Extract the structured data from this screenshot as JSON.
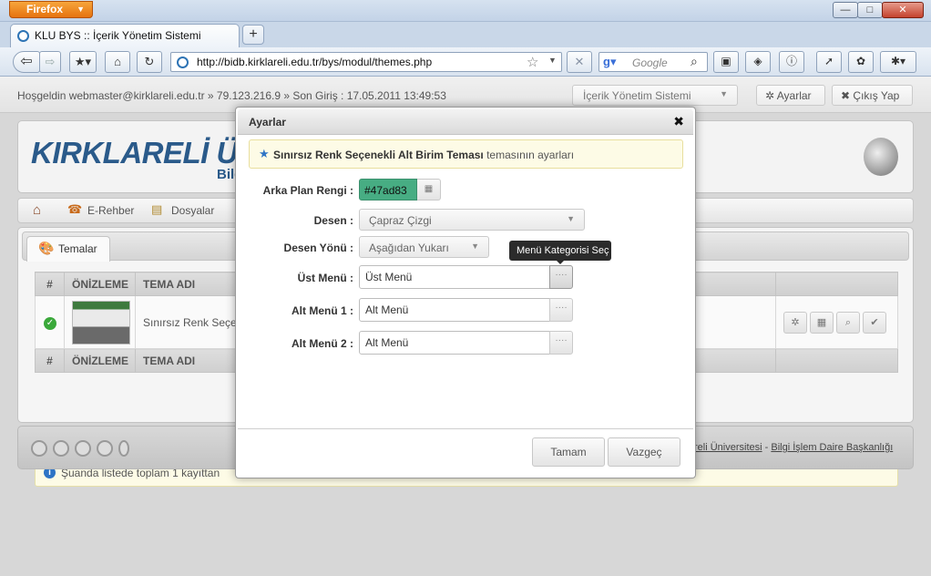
{
  "browser": {
    "menu_label": "Firefox",
    "tab_title": "KLU BYS :: İçerik Yönetim Sistemi",
    "url": "http://bidb.kirklareli.edu.tr/bys/modul/themes.php",
    "search_placeholder": "Google"
  },
  "topbar": {
    "welcome": "Hoşgeldin webmaster@kirklareli.edu.tr » 79.123.216.9 » Son Giriş : 17.05.2011 13:49:53",
    "module_select": "İçerik Yönetim Sistemi",
    "settings_label": "Ayarlar",
    "logout_label": "Çıkış Yap"
  },
  "header": {
    "logo_title": "KIRKLARELİ ÜNİ",
    "logo_sub": "Bilg"
  },
  "menu": {
    "erehber": "E-Rehber",
    "dosyalar": "Dosyalar"
  },
  "content": {
    "tab_label": "Temalar",
    "columns": [
      "#",
      "ÖNİZLEME",
      "TEMA ADI"
    ],
    "rows": [
      {
        "theme_name": "Sınırsız Renk Seçe"
      }
    ],
    "info_text": "Şuanda listede toplam 1 kayıttan"
  },
  "footer": {
    "link_university": "reli Üniversitesi",
    "separator": " - ",
    "link_department": "Bilgi İşlem Daire Başkanlığı"
  },
  "modal": {
    "title": "Ayarlar",
    "notice_bold": "Sınırsız Renk Seçenekli Alt Birim Teması",
    "notice_rest": " temasının ayarları",
    "labels": {
      "arka_plan": "Arka Plan Rengi :",
      "desen": "Desen :",
      "desen_yonu": "Desen Yönü :",
      "ust_menu": "Üst Menü :",
      "alt_menu_1": "Alt Menü 1 :",
      "alt_menu_2": "Alt Menü 2 :"
    },
    "values": {
      "arka_plan": "#47ad83",
      "desen": "Çapraz Çizgi",
      "desen_yonu": "Aşağıdan Yukarı",
      "ust_menu": "Üst Menü",
      "alt_menu_1": "Alt Menü",
      "alt_menu_2": "Alt Menü"
    },
    "tooltip": "Menü Kategorisi Seç",
    "ok_label": "Tamam",
    "cancel_label": "Vazgeç"
  },
  "colors": {
    "swatch": "#47ad83",
    "firefox_orange": "#e6730f",
    "logo_blue": "#2a5a8a"
  }
}
